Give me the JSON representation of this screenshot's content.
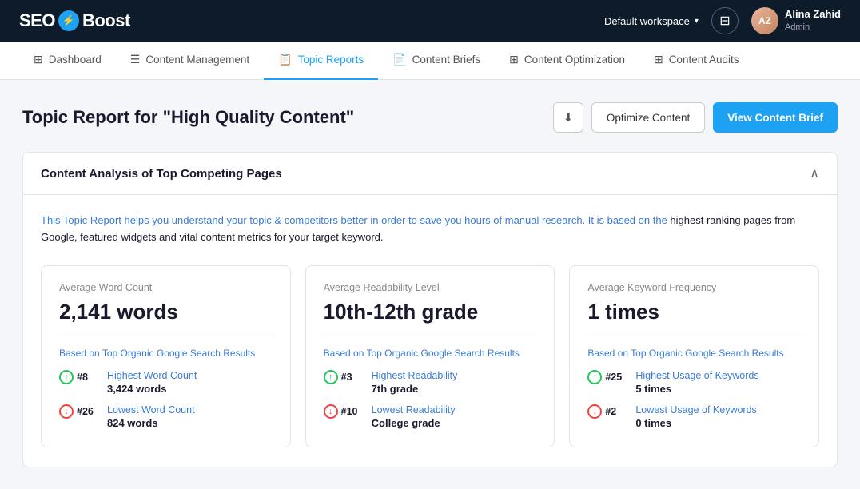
{
  "brand": {
    "logo_text_before": "SEO",
    "logo_icon": "⚡",
    "logo_text_after": "Boost"
  },
  "header": {
    "workspace_label": "Default workspace",
    "user_name": "Alina Zahid",
    "user_role": "Admin"
  },
  "nav": {
    "items": [
      {
        "id": "dashboard",
        "label": "Dashboard",
        "icon": "⊞"
      },
      {
        "id": "content-management",
        "label": "Content Management",
        "icon": "☰"
      },
      {
        "id": "topic-reports",
        "label": "Topic Reports",
        "icon": "📋",
        "active": true
      },
      {
        "id": "content-briefs",
        "label": "Content Briefs",
        "icon": "📄"
      },
      {
        "id": "content-optimization",
        "label": "Content Optimization",
        "icon": "⊞"
      },
      {
        "id": "content-audits",
        "label": "Content Audits",
        "icon": "⊞"
      }
    ]
  },
  "page": {
    "title": "Topic Report for \"High Quality Content\"",
    "btn_optimize": "Optimize Content",
    "btn_view_brief": "View Content Brief"
  },
  "section": {
    "title": "Content Analysis of Top Competing Pages",
    "info": "This Topic Report helps you understand your topic & competitors better in order to save you hours of manual research. It is based on the highest ranking pages from Google, featured widgets and vital content metrics for your target keyword.",
    "stats": [
      {
        "label": "Average Word Count",
        "value": "2,141 words",
        "source": "Based on Top Organic Google Search Results",
        "highest_rank": "#8",
        "highest_label": "Highest Word Count",
        "highest_value": "3,424 words",
        "lowest_rank": "#26",
        "lowest_label": "Lowest Word Count",
        "lowest_value": "824 words"
      },
      {
        "label": "Average Readability Level",
        "value": "10th-12th grade",
        "source": "Based on Top Organic Google Search Results",
        "highest_rank": "#3",
        "highest_label": "Highest Readability",
        "highest_value": "7th grade",
        "lowest_rank": "#10",
        "lowest_label": "Lowest Readability",
        "lowest_value": "College grade"
      },
      {
        "label": "Average Keyword Frequency",
        "value": "1 times",
        "source": "Based on Top Organic Google Search Results",
        "highest_rank": "#25",
        "highest_label": "Highest Usage of Keywords",
        "highest_value": "5 times",
        "lowest_rank": "#2",
        "lowest_label": "Lowest Usage of Keywords",
        "lowest_value": "0 times"
      }
    ]
  }
}
